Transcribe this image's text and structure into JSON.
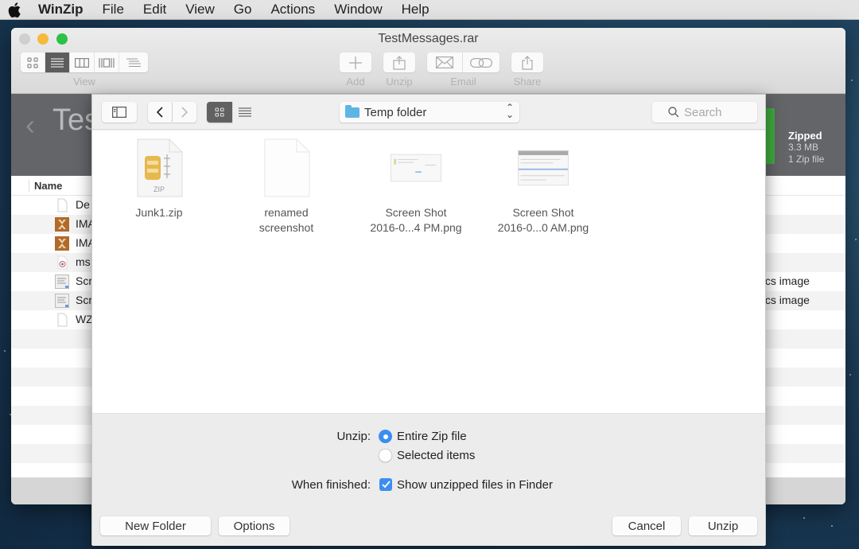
{
  "menubar": {
    "app_name": "WinZip",
    "items": [
      "File",
      "Edit",
      "View",
      "Go",
      "Actions",
      "Window",
      "Help"
    ]
  },
  "window": {
    "title": "TestMessages.rar",
    "view_label": "View",
    "view_modes": [
      "icons",
      "list",
      "columns",
      "coverflow",
      "text"
    ],
    "active_view_mode": "list",
    "toolbar": {
      "add": "Add",
      "unzip": "Unzip",
      "email": "Email",
      "share": "Share"
    },
    "archive_title": "Tes",
    "zipped": {
      "title": "Zipped",
      "size": "3.3 MB",
      "count": "1 Zip file"
    },
    "list_header": {
      "name": "Name"
    },
    "rows": [
      {
        "name": "De",
        "kind": "",
        "icon": "document-icon"
      },
      {
        "name": "IMA",
        "kind": "",
        "icon": "image-icon"
      },
      {
        "name": "IMA",
        "kind": "",
        "icon": "image-icon"
      },
      {
        "name": "ms",
        "kind": "",
        "icon": "message-icon"
      },
      {
        "name": "Scr",
        "kind": "nics image",
        "icon": "screenshot-icon"
      },
      {
        "name": "Scr",
        "kind": "nics image",
        "icon": "screenshot-icon"
      },
      {
        "name": "WZ",
        "kind": "",
        "icon": "document-icon"
      }
    ]
  },
  "sheet": {
    "path_popup": "Temp folder",
    "search_placeholder": "Search",
    "files": [
      {
        "line1": "Junk1.zip",
        "line2": "",
        "type": "zip",
        "zip_badge": "ZIP"
      },
      {
        "line1": "renamed",
        "line2": "screenshot",
        "type": "blank"
      },
      {
        "line1": "Screen Shot",
        "line2": "2016-0...4 PM.png",
        "type": "screenshot-small"
      },
      {
        "line1": "Screen Shot",
        "line2": "2016-0...0 AM.png",
        "type": "screenshot-large"
      }
    ],
    "options": {
      "unzip_label": "Unzip:",
      "radio_entire": "Entire Zip file",
      "radio_selected": "Selected items",
      "selected_radio": "entire",
      "when_finished_label": "When finished:",
      "show_in_finder": "Show unzipped files in Finder",
      "show_in_finder_checked": true
    },
    "buttons": {
      "new_folder": "New Folder",
      "options": "Options",
      "cancel": "Cancel",
      "unzip": "Unzip"
    }
  },
  "colors": {
    "accent": "#3b8ef0",
    "green_progress": "#3faa3f",
    "header_band": "#646569"
  }
}
